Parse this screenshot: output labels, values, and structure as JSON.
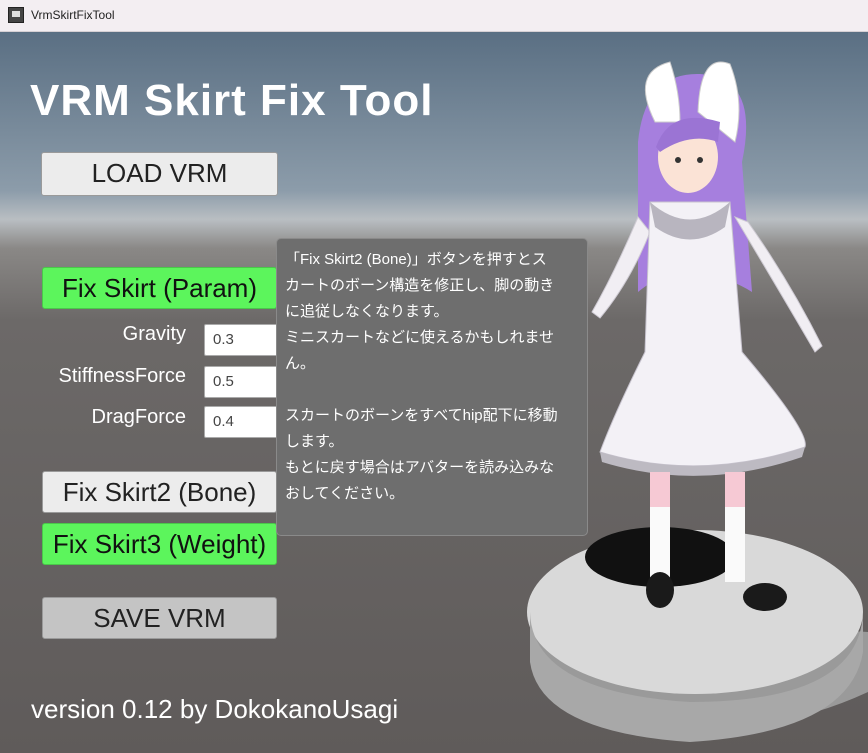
{
  "window": {
    "title": "VrmSkirtFixTool"
  },
  "header": {
    "title": "VRM Skirt Fix Tool"
  },
  "buttons": {
    "load": "LOAD VRM",
    "fix_param": "Fix Skirt (Param)",
    "fix_bone": "Fix Skirt2 (Bone)",
    "fix_weight": "Fix Skirt3 (Weight)",
    "save": "SAVE VRM"
  },
  "params": [
    {
      "label": "Gravity",
      "value": "0.3"
    },
    {
      "label": "StiffnessForce",
      "value": "0.5"
    },
    {
      "label": "DragForce",
      "value": "0.4"
    }
  ],
  "tooltip": {
    "lines": [
      "「Fix Skirt2 (Bone)」ボタンを押すとス",
      "カートのボーン構造を修正し、脚の動き",
      "に追従しなくなります。",
      "ミニスカートなどに使えるかもしれませ",
      "ん。",
      "",
      "スカートのボーンをすべてhip配下に移動",
      "します。",
      "もとに戻す場合はアバターを読み込みな",
      "おしてください。"
    ]
  },
  "footer": {
    "version": "version 0.12 by DokokanoUsagi"
  },
  "colors": {
    "accent_green": "#5cf55c",
    "tooltip_bg": "#6e6e6e",
    "viewport_floor": "#5f5b5a"
  },
  "icons": {
    "app": "app-icon"
  }
}
